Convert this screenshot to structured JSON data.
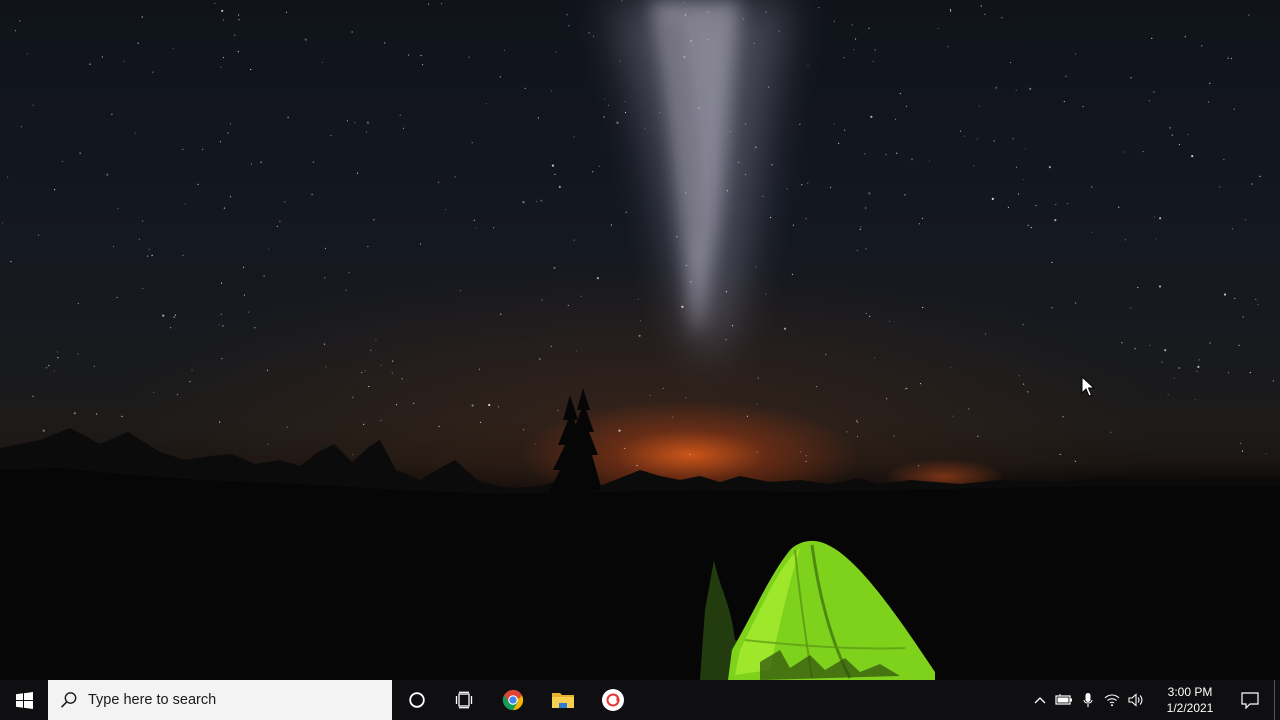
{
  "desktop": {
    "wallpaper": "night-sky-camping-tent",
    "colors": {
      "sky": "#131720",
      "horizon_glow": "#e6601c",
      "tent": "#7fd21c",
      "foreground": "#050505"
    }
  },
  "taskbar": {
    "background": "#0f0f12",
    "start_icon": "windows-logo-icon",
    "search": {
      "placeholder": "Type here to search",
      "icon": "search-icon"
    },
    "cortana_icon": "cortana-circle-icon",
    "taskview_icon": "task-view-icon",
    "pinned_apps": [
      {
        "name": "Google Chrome",
        "icon": "chrome-icon"
      },
      {
        "name": "File Explorer",
        "icon": "folder-icon"
      },
      {
        "name": "Recorder",
        "icon": "recorder-icon"
      }
    ],
    "tray": {
      "icons": [
        "chevron-up-icon",
        "battery-icon",
        "microphone-icon",
        "wifi-icon",
        "volume-icon"
      ],
      "time": "3:00 PM",
      "date": "1/2/2021",
      "notification_icon": "notification-icon"
    }
  }
}
